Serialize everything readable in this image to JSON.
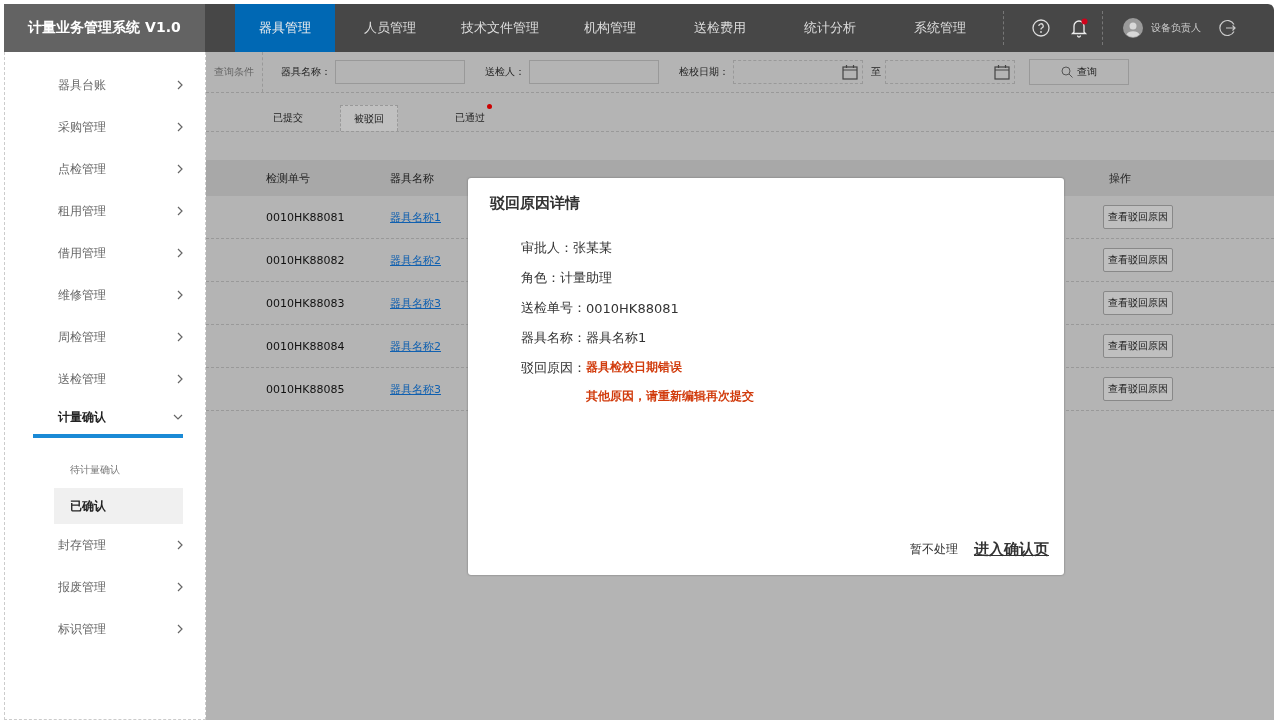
{
  "app_title": "计量业务管理系统 V1.0",
  "nav": [
    {
      "label": "器具管理",
      "selected": true
    },
    {
      "label": "人员管理",
      "selected": false
    },
    {
      "label": "技术文件管理",
      "selected": false
    },
    {
      "label": "机构管理",
      "selected": false
    },
    {
      "label": "送检费用",
      "selected": false
    },
    {
      "label": "统计分析",
      "selected": false
    },
    {
      "label": "系统管理",
      "selected": false
    }
  ],
  "notifications": {
    "unread": true
  },
  "user": {
    "name": "设备负责人"
  },
  "sidebar": {
    "items": [
      {
        "label": "器具台账",
        "expanded": false
      },
      {
        "label": "采购管理",
        "expanded": false
      },
      {
        "label": "点检管理",
        "expanded": false
      },
      {
        "label": "租用管理",
        "expanded": false
      },
      {
        "label": "借用管理",
        "expanded": false
      },
      {
        "label": "维修管理",
        "expanded": false
      },
      {
        "label": "周检管理",
        "expanded": false
      },
      {
        "label": "送检管理",
        "expanded": false
      },
      {
        "label": "计量确认",
        "expanded": true,
        "children": [
          {
            "label": "待计量确认",
            "selected": false
          },
          {
            "label": "已确认",
            "selected": true
          }
        ]
      },
      {
        "label": "封存管理",
        "expanded": false
      },
      {
        "label": "报废管理",
        "expanded": false
      },
      {
        "label": "标识管理",
        "expanded": false
      }
    ]
  },
  "filters": {
    "label": "查询条件",
    "fields": [
      {
        "label": "器具名称：",
        "kind": "text"
      },
      {
        "label": "送检人：",
        "kind": "text"
      },
      {
        "label": "检校日期：",
        "kind": "daterange",
        "separator": "至"
      }
    ],
    "search_button": "查询"
  },
  "tabs": [
    {
      "label": "已提交",
      "selected": false,
      "badge": false
    },
    {
      "label": "被驳回",
      "selected": true,
      "badge": false
    },
    {
      "label": "已通过",
      "selected": false,
      "badge": true
    }
  ],
  "table": {
    "columns": [
      "检测单号",
      "器具名称",
      "操作"
    ],
    "rows": [
      {
        "code": "0010HK88081",
        "name": "器具名称1",
        "action": "查看驳回原因"
      },
      {
        "code": "0010HK88082",
        "name": "器具名称2",
        "action": "查看驳回原因"
      },
      {
        "code": "0010HK88083",
        "name": "器具名称3",
        "action": "查看驳回原因"
      },
      {
        "code": "0010HK88084",
        "name": "器具名称2",
        "action": "查看驳回原因"
      },
      {
        "code": "0010HK88085",
        "name": "器具名称3",
        "action": "查看驳回原因"
      }
    ]
  },
  "dialog": {
    "title": "驳回原因详情",
    "fields": [
      {
        "label": "审批人：",
        "value": "张某某"
      },
      {
        "label": "角色：",
        "value": "计量助理"
      },
      {
        "label": "送检单号：",
        "value": "0010HK88081"
      },
      {
        "label": "器具名称：",
        "value": "器具名称1"
      }
    ],
    "reason_label": "驳回原因：",
    "reasons": [
      "器具检校日期错误",
      "其他原因，请重新编辑再次提交"
    ],
    "cancel": "暂不处理",
    "confirm": "进入确认页"
  }
}
